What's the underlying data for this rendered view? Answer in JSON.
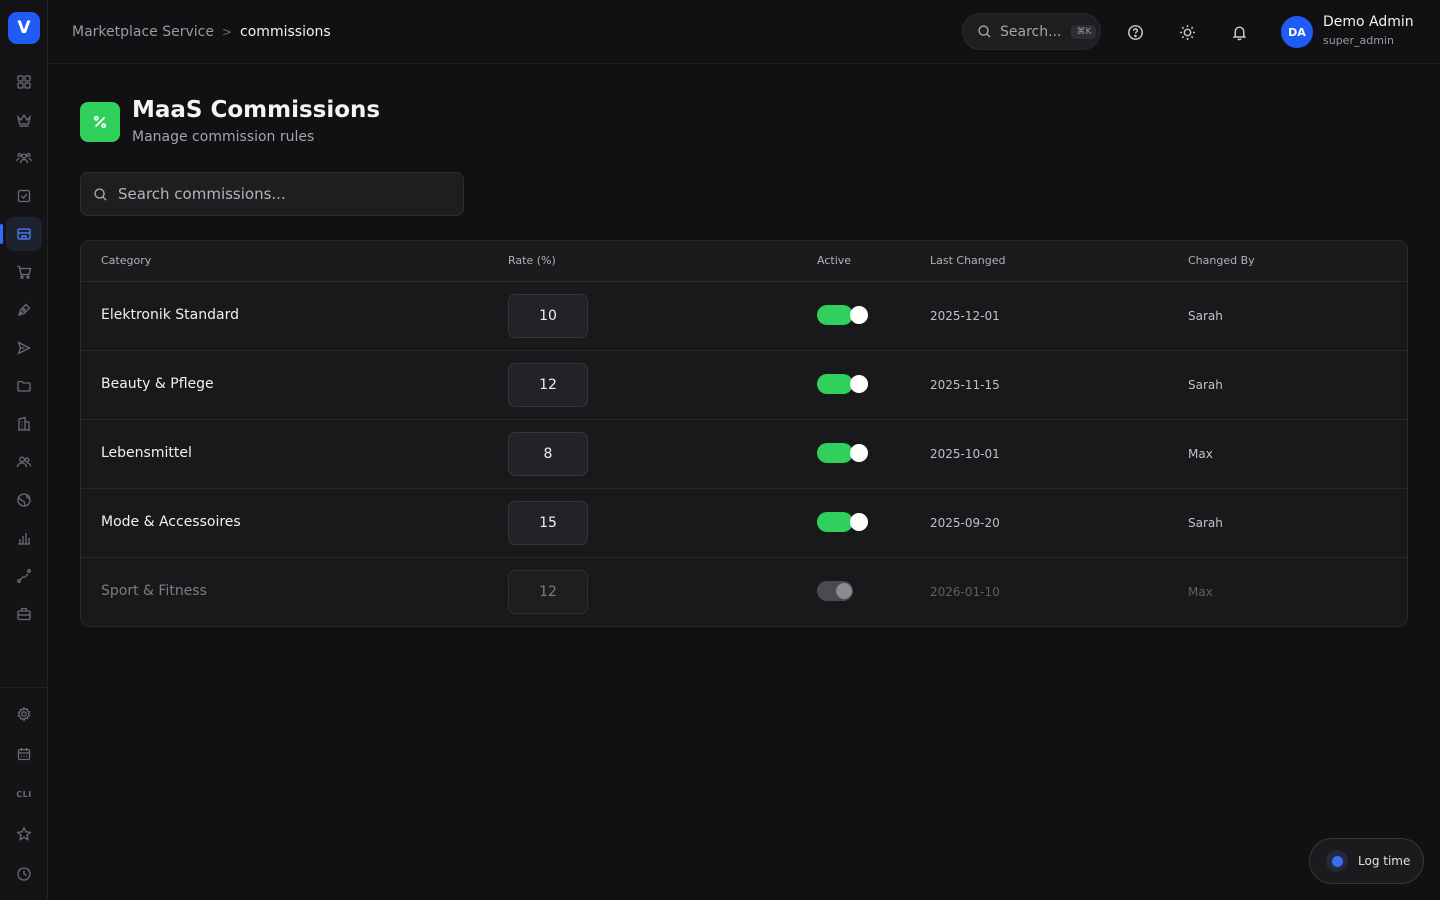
{
  "app": {
    "logo_letter": "V"
  },
  "sidebar": {
    "items": [
      {
        "icon": "dashboard-grid-icon"
      },
      {
        "icon": "crown-icon"
      },
      {
        "icon": "users-group-icon"
      },
      {
        "icon": "checkbox-icon"
      },
      {
        "icon": "store-icon",
        "active": true
      },
      {
        "icon": "cart-icon"
      },
      {
        "icon": "pen-nib-icon"
      },
      {
        "icon": "send-icon"
      },
      {
        "icon": "folder-icon"
      },
      {
        "icon": "building-icon"
      },
      {
        "icon": "people-icon"
      },
      {
        "icon": "globe-icon"
      },
      {
        "icon": "bar-chart-icon"
      },
      {
        "icon": "route-icon"
      },
      {
        "icon": "briefcase-icon"
      }
    ],
    "bottom_items": [
      {
        "icon": "gear-icon"
      },
      {
        "icon": "calendar-icon"
      },
      {
        "icon": "cli-icon",
        "label": "CLI"
      },
      {
        "icon": "star-icon"
      },
      {
        "icon": "clock-icon"
      }
    ]
  },
  "header": {
    "breadcrumb": {
      "parent": "Marketplace Service",
      "separator": ">",
      "current": "commissions"
    },
    "search": {
      "placeholder": "Search...",
      "shortcut": "⌘K"
    },
    "user": {
      "initials": "DA",
      "name": "Demo Admin",
      "role": "super_admin"
    }
  },
  "page": {
    "title": "MaaS Commissions",
    "subtitle": "Manage commission rules",
    "icon": "percent-icon",
    "accent_color": "#2fd05b"
  },
  "search": {
    "placeholder": "Search commissions..."
  },
  "table": {
    "columns": [
      "Category",
      "Rate (%)",
      "Active",
      "Last Changed",
      "Changed By"
    ],
    "rows": [
      {
        "category": "Elektronik Standard",
        "rate": "10",
        "active": true,
        "last_changed": "2025-12-01",
        "changed_by": "Sarah"
      },
      {
        "category": "Beauty & Pflege",
        "rate": "12",
        "active": true,
        "last_changed": "2025-11-15",
        "changed_by": "Sarah"
      },
      {
        "category": "Lebensmittel",
        "rate": "8",
        "active": true,
        "last_changed": "2025-10-01",
        "changed_by": "Max"
      },
      {
        "category": "Mode & Accessoires",
        "rate": "15",
        "active": true,
        "last_changed": "2025-09-20",
        "changed_by": "Sarah"
      },
      {
        "category": "Sport & Fitness",
        "rate": "12",
        "active": false,
        "last_changed": "2026-01-10",
        "changed_by": "Max"
      }
    ]
  },
  "log_time": {
    "label": "Log time"
  },
  "colors": {
    "brand": "#1f5cf4",
    "toggle_on": "#2fd05b",
    "toggle_off": "#4a4a50"
  }
}
